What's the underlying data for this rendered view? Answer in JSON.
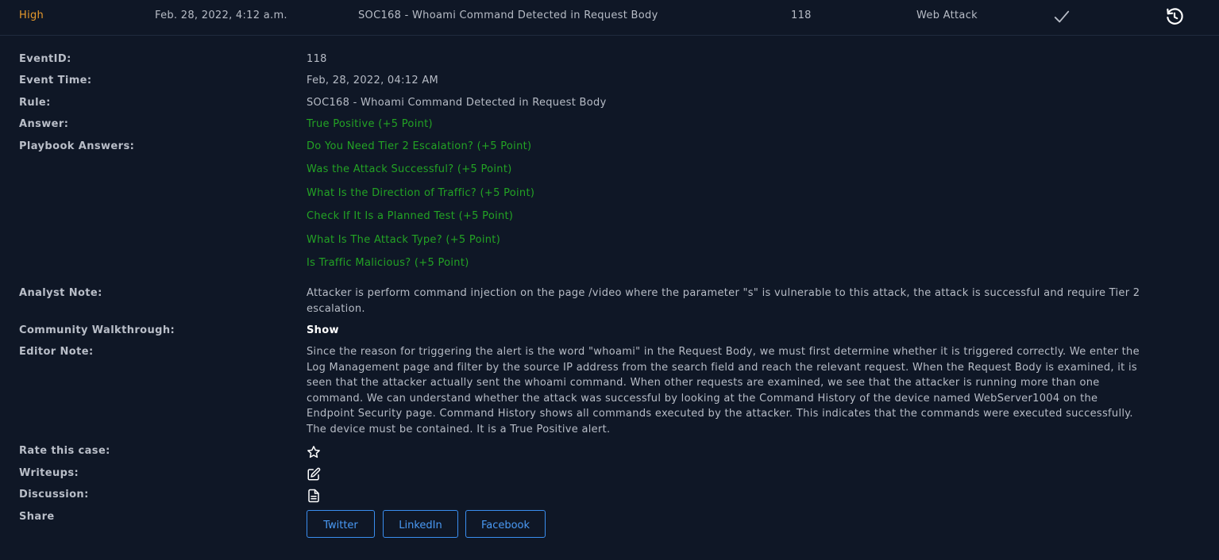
{
  "summary": {
    "severity": "High",
    "date": "Feb. 28, 2022, 4:12 a.m.",
    "rule": "SOC168 - Whoami Command Detected in Request Body",
    "event_id": "118",
    "type": "Web Attack",
    "status_icon": "check-icon",
    "action_icon": "restore-icon"
  },
  "details": {
    "event_id_label": "EventID:",
    "event_id_value": "118",
    "event_time_label": "Event Time:",
    "event_time_value": "Feb, 28, 2022, 04:12 AM",
    "rule_label": "Rule:",
    "rule_value": "SOC168 - Whoami Command Detected in Request Body",
    "answer_label": "Answer:",
    "answer_value": "True Positive (+5 Point)",
    "playbook_label": "Playbook Answers:",
    "playbook_answers": [
      "Do You Need Tier 2 Escalation? (+5 Point)",
      "Was the Attack Successful? (+5 Point)",
      "What Is the Direction of Traffic? (+5 Point)",
      "Check If It Is a Planned Test (+5 Point)",
      "What Is The Attack Type? (+5 Point)",
      "Is Traffic Malicious? (+5 Point)"
    ],
    "analyst_note_label": "Analyst Note:",
    "analyst_note_value": "Attacker is perform command injection on the page /video where the parameter \"s\" is vulnerable to this attack, the attack is successful and require Tier 2 escalation.",
    "community_label": "Community Walkthrough:",
    "community_value": "Show",
    "editor_note_label": "Editor Note:",
    "editor_note_value": "Since the reason for triggering the alert is the word \"whoami\" in the Request Body, we must first determine whether it is triggered correctly. We enter the Log Management page and filter by the source IP address from the search field and reach the relevant request. When the Request Body is examined, it is seen that the attacker actually sent the whoami command. When other requests are examined, we see that the attacker is running more than one command. We can understand whether the attack was successful by looking at the Command History of the device named WebServer1004 on the Endpoint Security page. Command History shows all commands executed by the attacker. This indicates that the commands were executed successfully. The device must be contained. It is a True Positive alert.",
    "rate_label": "Rate this case:",
    "writeups_label": "Writeups:",
    "discussion_label": "Discussion:",
    "share_label": "Share",
    "share_buttons": [
      "Twitter",
      "LinkedIn",
      "Facebook"
    ]
  },
  "colors": {
    "background": "#0f1726",
    "severity_high": "#e89a2c",
    "answer_green": "#23a324",
    "link_blue": "#4a9af5"
  }
}
